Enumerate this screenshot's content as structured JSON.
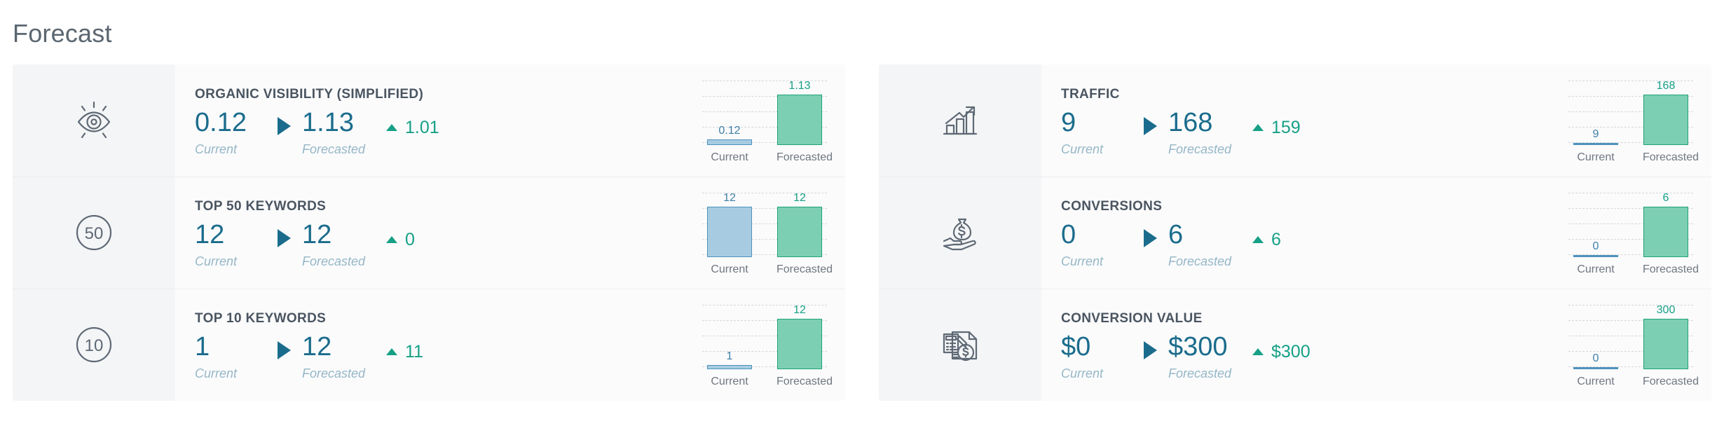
{
  "page": {
    "title": "Forecast"
  },
  "chart_axis": {
    "current_label": "Current",
    "forecasted_label": "Forecasted"
  },
  "labels": {
    "current": "Current",
    "forecasted": "Forecasted"
  },
  "colors": {
    "current_value": "#1b6c8c",
    "delta_positive": "#16a085",
    "bar_current_fill": "#a7cce2",
    "bar_current_stroke": "#4e92bb",
    "bar_forecast_fill": "#7ccfb2",
    "bar_forecast_stroke": "#21a179",
    "icon_panel": "#f4f5f6",
    "title_text": "#5b6670"
  },
  "columns": [
    {
      "cards": [
        {
          "icon": "eye-visibility-icon",
          "title": "ORGANIC VISIBILITY (SIMPLIFIED)",
          "current_value": "0.12",
          "current_label": "Current",
          "forecast_value": "1.13",
          "forecast_label": "Forecasted",
          "delta_direction": "up",
          "delta_value": "1.01",
          "chart_data": {
            "type": "bar",
            "categories": [
              "Current",
              "Forecasted"
            ],
            "values": [
              0.12,
              1.13
            ],
            "data_labels": [
              "0.12",
              "1.13"
            ],
            "ylim": [
              0,
              1.13
            ],
            "grid": true,
            "gridlines": 4,
            "legend": "none",
            "title": "ORGANIC VISIBILITY (SIMPLIFIED)",
            "xlabel": "",
            "ylabel": ""
          }
        },
        {
          "icon": "circle-50-icon",
          "title": "TOP 50 KEYWORDS",
          "current_value": "12",
          "current_label": "Current",
          "forecast_value": "12",
          "forecast_label": "Forecasted",
          "delta_direction": "up",
          "delta_value": "0",
          "chart_data": {
            "type": "bar",
            "categories": [
              "Current",
              "Forecasted"
            ],
            "values": [
              12,
              12
            ],
            "data_labels": [
              "12",
              "12"
            ],
            "ylim": [
              0,
              12
            ],
            "grid": true,
            "gridlines": 4,
            "legend": "none",
            "title": "TOP 50 KEYWORDS",
            "xlabel": "",
            "ylabel": ""
          }
        },
        {
          "icon": "circle-10-icon",
          "title": "TOP 10 KEYWORDS",
          "current_value": "1",
          "current_label": "Current",
          "forecast_value": "12",
          "forecast_label": "Forecasted",
          "delta_direction": "up",
          "delta_value": "11",
          "chart_data": {
            "type": "bar",
            "categories": [
              "Current",
              "Forecasted"
            ],
            "values": [
              1,
              12
            ],
            "data_labels": [
              "1",
              "12"
            ],
            "ylim": [
              0,
              12
            ],
            "grid": true,
            "gridlines": 4,
            "legend": "none",
            "title": "TOP 10 KEYWORDS",
            "xlabel": "",
            "ylabel": ""
          }
        }
      ]
    },
    {
      "cards": [
        {
          "icon": "growth-chart-arrow-icon",
          "title": "TRAFFIC",
          "current_value": "9",
          "current_label": "Current",
          "forecast_value": "168",
          "forecast_label": "Forecasted",
          "delta_direction": "up",
          "delta_value": "159",
          "chart_data": {
            "type": "bar",
            "categories": [
              "Current",
              "Forecasted"
            ],
            "values": [
              9,
              168
            ],
            "data_labels": [
              "9",
              "168"
            ],
            "ylim": [
              0,
              168
            ],
            "grid": true,
            "gridlines": 4,
            "legend": "none",
            "title": "TRAFFIC",
            "xlabel": "",
            "ylabel": ""
          }
        },
        {
          "icon": "hand-money-bag-icon",
          "title": "CONVERSIONS",
          "current_value": "0",
          "current_label": "Current",
          "forecast_value": "6",
          "forecast_label": "Forecasted",
          "delta_direction": "up",
          "delta_value": "6",
          "chart_data": {
            "type": "bar",
            "categories": [
              "Current",
              "Forecasted"
            ],
            "values": [
              0,
              6
            ],
            "data_labels": [
              "0",
              "6"
            ],
            "ylim": [
              0,
              6
            ],
            "grid": true,
            "gridlines": 4,
            "legend": "none",
            "title": "CONVERSIONS",
            "xlabel": "",
            "ylabel": ""
          }
        },
        {
          "icon": "calculator-invoice-dollar-icon",
          "title": "CONVERSION VALUE",
          "current_value": "$0",
          "current_label": "Current",
          "forecast_value": "$300",
          "forecast_label": "Forecasted",
          "delta_direction": "up",
          "delta_value": "$300",
          "chart_data": {
            "type": "bar",
            "categories": [
              "Current",
              "Forecasted"
            ],
            "values": [
              0,
              300
            ],
            "data_labels": [
              "0",
              "300"
            ],
            "ylim": [
              0,
              300
            ],
            "grid": true,
            "gridlines": 4,
            "legend": "none",
            "title": "CONVERSION VALUE",
            "xlabel": "",
            "ylabel": ""
          }
        }
      ]
    }
  ]
}
